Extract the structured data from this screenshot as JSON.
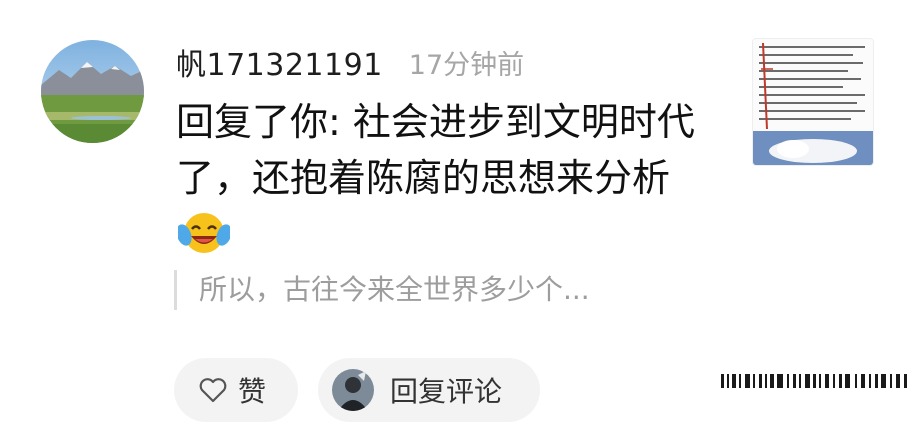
{
  "comment": {
    "username": "帆171321191",
    "time": "17分钟前",
    "text": "回复了你: 社会进步到文明时代了，还抱着陈腐的思想来分析",
    "emoji_icon": "laughing-tears-emoji",
    "quoted_text": "所以，古往今来全世界多少个..."
  },
  "actions": {
    "like_label": "赞",
    "reply_label": "回复评论",
    "like_icon": "heart-outline-icon"
  }
}
